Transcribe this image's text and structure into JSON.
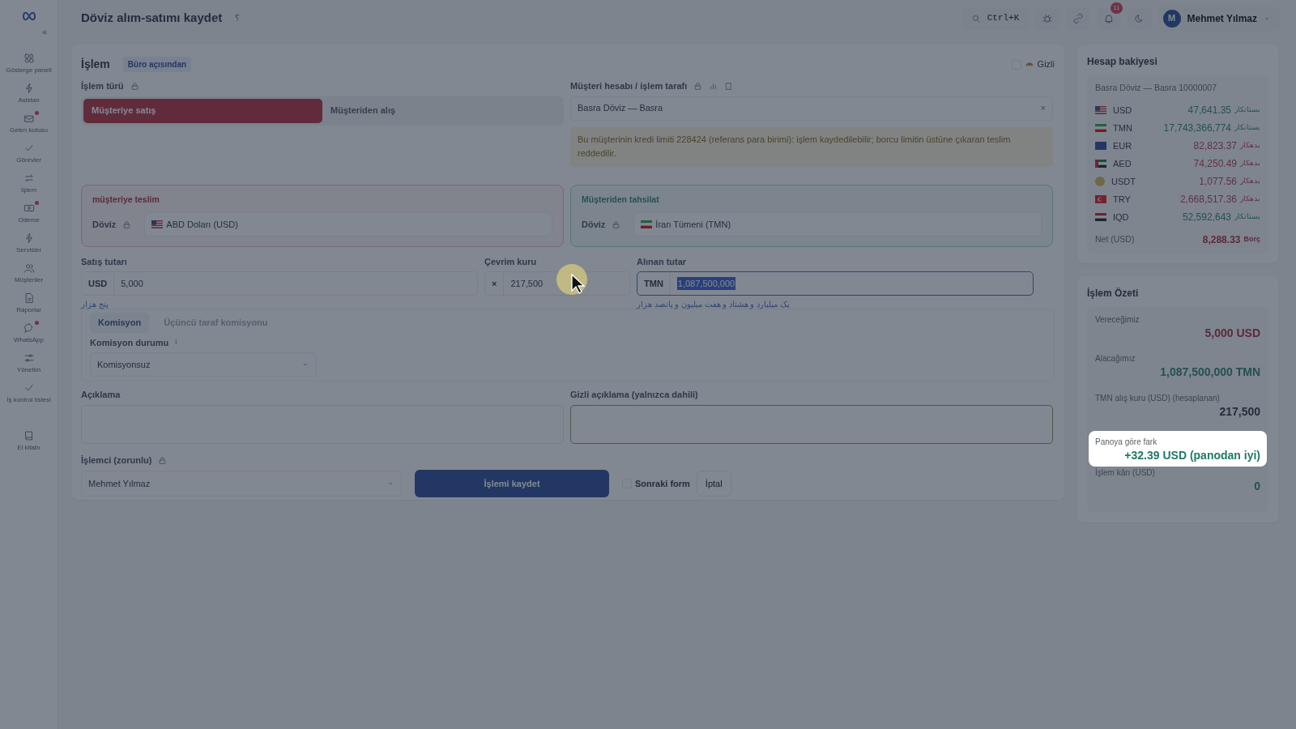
{
  "collapse_mark": "«",
  "header": {
    "title": "Döviz alım-satımı kaydet",
    "help_mark": "؟",
    "search_shortcut": "Ctrl+K",
    "notification_count": "11",
    "user": {
      "initial": "M",
      "name": "Mehmet Yılmaz"
    }
  },
  "sidebar": {
    "items": [
      {
        "label": "Gösterge paneli",
        "kind": "grid",
        "dot": false
      },
      {
        "label": "Asistan",
        "kind": "bolt",
        "dot": false
      },
      {
        "label": "Gelen kutusu",
        "kind": "inbox",
        "dot": true
      },
      {
        "label": "Görevler",
        "kind": "check",
        "dot": false
      },
      {
        "label": "İşlem",
        "kind": "swap",
        "dot": false
      },
      {
        "label": "Odeme",
        "kind": "cash",
        "dot": true
      },
      {
        "label": "Servisler",
        "kind": "bolt",
        "dot": false
      },
      {
        "label": "Müşteriler",
        "kind": "users",
        "dot": false
      },
      {
        "label": "Raporlar",
        "kind": "file",
        "dot": false
      },
      {
        "label": "WhatsApp",
        "kind": "chat",
        "dot": true
      },
      {
        "label": "Yönetim",
        "kind": "sliders",
        "dot": false
      },
      {
        "label": "İş kontrol listesi",
        "kind": "check",
        "dot": false
      },
      {
        "label": "El kitabı",
        "kind": "book",
        "dot": false
      }
    ]
  },
  "form": {
    "title": "İşlem",
    "badge": "Büro açısından",
    "hidden_label": "Gizli",
    "hidden_checked": false,
    "type_label": "İşlem türü",
    "type_options": [
      {
        "label": "Müşteriye satış",
        "selected": true
      },
      {
        "label": "Müşteriden alış",
        "selected": false
      }
    ],
    "customer_label": "Müşteri hesabı / işlem tarafı",
    "customer_value": "Basra Döviz — Basra",
    "clear_mark": "×",
    "warning": "Bu müşterinin kredi limiti 228424 (referans para birimi): işlem kaydedilebilir; borcu limitin üstüne çıkaran teslim reddedilir.",
    "legs": [
      {
        "title": "müşteriye teslim",
        "kind": "delivery",
        "field_label": "Döviz",
        "currency": {
          "name": "ABD Doları (USD)",
          "kind": "us"
        }
      },
      {
        "title": "Müşteriden tahsilat",
        "kind": "collection",
        "field_label": "Döviz",
        "currency": {
          "name": "İran Tümeni (TMN)",
          "kind": "ir"
        }
      }
    ],
    "sale_amount": {
      "label": "Satış tutarı",
      "prefix": "USD",
      "value": "5,000",
      "words": "پنج هزار"
    },
    "rate": {
      "label": "Çevrim kuru",
      "prefix": "×",
      "value": "217,500"
    },
    "received": {
      "label": "Alınan tutar",
      "prefix": "TMN",
      "value": "1,087,500,000",
      "text_selected": true,
      "words": "یک میلیارد و هشتاد و هفت میلیون و پانصد هزار"
    },
    "commission_tabs": [
      {
        "label": "Komisyon",
        "selected": true
      },
      {
        "label": "Üçüncü taraf komisyonu",
        "selected": false
      }
    ],
    "commission_status_label": "Komisyon durumu",
    "commission_info": "i",
    "commission_status": "Komisyonsuz",
    "note_label": "Açıklama",
    "private_note_label": "Gizli açıklama (yalnızca dahili)",
    "operator_label": "İşlemci (zorunlu)",
    "operator": "Mehmet Yılmaz",
    "save_button": "İşlemi kaydet",
    "next_form_label": "Sonraki form",
    "next_form_checked": false,
    "cancel_button": "İptal"
  },
  "balance": {
    "title": "Hesap bakiyesi",
    "account": "Basra Döviz — Basra 10000007",
    "rows": [
      {
        "code": "USD",
        "kind": "us",
        "amount": "47,641.35",
        "status": "بستانکار",
        "debit": false
      },
      {
        "code": "TMN",
        "kind": "ir",
        "amount": "17,743,366,774",
        "status": "بستانکار",
        "debit": false
      },
      {
        "code": "EUR",
        "kind": "eu",
        "amount": "82,823.37",
        "status": "بدهکار",
        "debit": true
      },
      {
        "code": "AED",
        "kind": "ae",
        "amount": "74,250.49",
        "status": "بدهکار",
        "debit": true
      },
      {
        "code": "USDT",
        "kind": "coin",
        "amount": "1,077.56",
        "status": "بدهکار",
        "debit": true
      },
      {
        "code": "TRY",
        "kind": "tr",
        "amount": "2,668,517.36",
        "status": "بدهکار",
        "debit": true
      },
      {
        "code": "IQD",
        "kind": "iq",
        "amount": "52,592,643",
        "status": "بستانکار",
        "debit": false
      }
    ],
    "net_label": "Net (USD)",
    "net_value": "8,288.33",
    "net_status": "Borç"
  },
  "summary": {
    "title": "İşlem Özeti",
    "items": [
      {
        "label": "Vereceğimiz",
        "value": "5,000 USD",
        "kind": "debit",
        "highlighted": false
      },
      {
        "label": "Alacağımız",
        "value": "1,087,500,000 TMN",
        "kind": "credit",
        "highlighted": false
      },
      {
        "label": "TMN alış kuru (USD) (hesaplanan)",
        "value": "217,500",
        "kind": "rate",
        "highlighted": false
      },
      {
        "label": "Panoya göre fark",
        "value": "+32.39 USD (panodan iyi)",
        "kind": "credit",
        "highlighted": true
      },
      {
        "label": "İşlem kârı (USD)",
        "value": "0",
        "kind": "credit",
        "highlighted": false
      }
    ]
  }
}
